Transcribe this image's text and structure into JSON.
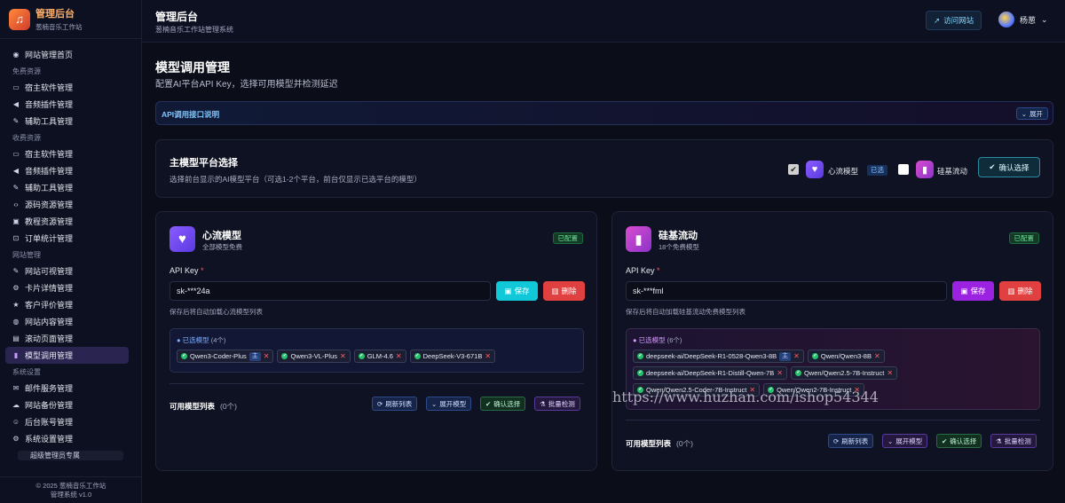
{
  "brand": {
    "title": "管理后台",
    "subtitle": "葱楠音乐工作站"
  },
  "nav": {
    "home": "网站管理首页",
    "sec_free": "免费资源",
    "free": [
      "宿主软件管理",
      "音频插件管理",
      "辅助工具管理"
    ],
    "sec_paid": "收费资源",
    "paid": [
      "宿主软件管理",
      "音频插件管理",
      "辅助工具管理",
      "源码资源管理",
      "教程资源管理",
      "订单统计管理"
    ],
    "sec_site": "网站管理",
    "site": [
      "网站可视管理",
      "卡片详情管理",
      "客户评价管理",
      "网站内容管理",
      "滚动页面管理",
      "模型调用管理"
    ],
    "sec_sys": "系统设置",
    "sys": [
      "邮件服务管理",
      "网站备份管理",
      "后台账号管理",
      "系统设置管理"
    ],
    "super": "超级管理员专属"
  },
  "footer": {
    "line1": "© 2025 葱楠音乐工作站",
    "line2": "管理系统 v1.0"
  },
  "topbar": {
    "title": "管理后台",
    "subtitle": "葱楠音乐工作站管理系统",
    "visit": "访问网站",
    "user": "杨葱"
  },
  "page": {
    "title": "模型调用管理",
    "subtitle": "配置AI平台API Key，选择可用模型并检测延迟"
  },
  "api_bar": {
    "title": "API调用接口说明",
    "expand": "展开"
  },
  "platform": {
    "title": "主模型平台选择",
    "subtitle": "选择前台显示的AI模型平台（可选1-2个平台，前台仅显示已选平台的模型）",
    "p1": "心流模型",
    "p1_tag": "已选",
    "p2": "硅基流动",
    "confirm": "确认选择"
  },
  "left": {
    "title": "心流模型",
    "subtitle": "全部模型免费",
    "status": "已配置",
    "key_label": "API Key",
    "key_value": "sk-***24a",
    "save": "保存",
    "delete": "删除",
    "hint": "保存后将自动加载心流模型列表",
    "selected_title": "已选模型",
    "selected_count": "(4个)",
    "chips": [
      "Qwen3-Coder-Plus",
      "Qwen3-VL-Plus",
      "GLM-4.6",
      "DeepSeek-V3-671B"
    ],
    "main_tag": "主",
    "avail": "可用模型列表",
    "avail_count": "(0个)",
    "refresh": "刷新列表",
    "expand": "展开模型",
    "confirm": "确认选择",
    "batch": "批量检测"
  },
  "right": {
    "title": "硅基流动",
    "subtitle": "18个免费模型",
    "status": "已配置",
    "key_label": "API Key",
    "key_value": "sk-***fml",
    "save": "保存",
    "delete": "删除",
    "hint": "保存后将自动加载硅基流动免费模型列表",
    "selected_title": "已选模型",
    "selected_count": "(6个)",
    "chips": [
      "deepseek-ai/DeepSeek-R1-0528-Qwen3-8B",
      "Qwen/Qwen3-8B",
      "deepseek-ai/DeepSeek-R1-Distill-Qwen-7B",
      "Qwen/Qwen2.5-7B-Instruct",
      "Qwen/Qwen2.5-Coder-7B-Instruct",
      "Qwen/Qwen2-7B-Instruct"
    ],
    "main_tag": "主",
    "avail": "可用模型列表",
    "avail_count": "(0个)",
    "refresh": "刷新列表",
    "expand": "展开模型",
    "confirm": "确认选择",
    "batch": "批量检测"
  },
  "watermark": "https://www.huzhan.com/ishop54344"
}
